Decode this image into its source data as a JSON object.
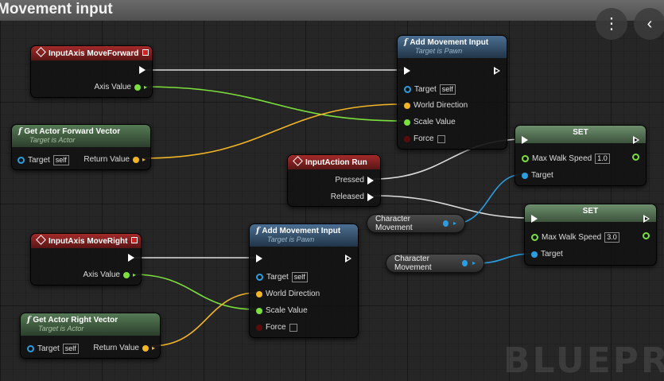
{
  "graph_title": "Movement input",
  "watermark": "BLUEPRINT",
  "nodes": {
    "axis_forward": {
      "title": "InputAxis MoveForward",
      "axis_value": "Axis Value"
    },
    "fwd_vector": {
      "title": "Get Actor Forward Vector",
      "subtitle": "Target is Actor",
      "target": "Target",
      "self": "self",
      "return_value": "Return Value"
    },
    "add_move_top": {
      "title": "Add Movement Input",
      "subtitle": "Target is Pawn",
      "target": "Target",
      "self": "self",
      "world_direction": "World Direction",
      "scale_value": "Scale Value",
      "force": "Force"
    },
    "set_top": {
      "title": "SET",
      "max_walk_speed": "Max Walk Speed",
      "value": "1.0",
      "target": "Target"
    },
    "action_run": {
      "title": "InputAction Run",
      "pressed": "Pressed",
      "released": "Released"
    },
    "char_move_1": {
      "label": "Character Movement"
    },
    "set_bottom": {
      "title": "SET",
      "max_walk_speed": "Max Walk Speed",
      "value": "3.0",
      "target": "Target"
    },
    "char_move_2": {
      "label": "Character Movement"
    },
    "axis_right": {
      "title": "InputAxis MoveRight",
      "axis_value": "Axis Value"
    },
    "add_move_bottom": {
      "title": "Add Movement Input",
      "subtitle": "Target is Pawn",
      "target": "Target",
      "self": "self",
      "world_direction": "World Direction",
      "scale_value": "Scale Value",
      "force": "Force"
    },
    "right_vector": {
      "title": "Get Actor Right Vector",
      "subtitle": "Target is Actor",
      "target": "Target",
      "self": "self",
      "return_value": "Return Value"
    }
  },
  "icons": {
    "more": "vertical-dots-icon",
    "back": "chevron-left-icon"
  },
  "colors": {
    "exec": "#ffffff",
    "float": "#7be03b",
    "vector": "#f2b524",
    "object": "#2a9ee0",
    "event_header": "#a42a2a",
    "pure_header": "#557a55",
    "function_header": "#4b6f92"
  }
}
